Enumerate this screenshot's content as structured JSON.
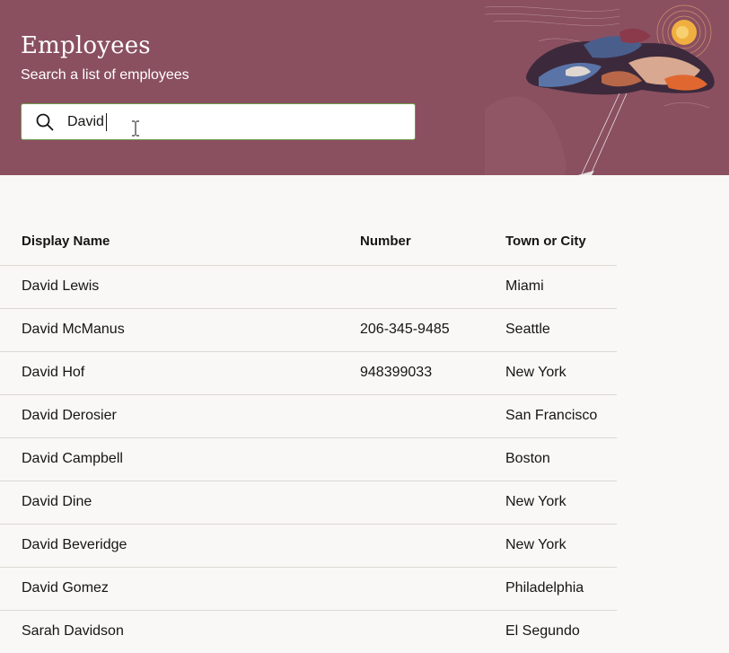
{
  "header": {
    "title": "Employees",
    "subtitle": "Search a list of employees",
    "background_color": "#8a5060"
  },
  "search": {
    "icon": "search-icon",
    "value": "David"
  },
  "table": {
    "columns": [
      "Display Name",
      "Number",
      "Town or City"
    ],
    "rows": [
      {
        "name": "David Lewis",
        "number": "",
        "city": "Miami"
      },
      {
        "name": "David McManus",
        "number": "206-345-9485",
        "city": "Seattle"
      },
      {
        "name": "David Hof",
        "number": "948399033",
        "city": "New York"
      },
      {
        "name": "David Derosier",
        "number": "",
        "city": "San Francisco"
      },
      {
        "name": "David Campbell",
        "number": "",
        "city": "Boston"
      },
      {
        "name": "David Dine",
        "number": "",
        "city": "New York"
      },
      {
        "name": "David Beveridge",
        "number": "",
        "city": "New York"
      },
      {
        "name": "David Gomez",
        "number": "",
        "city": "Philadelphia"
      },
      {
        "name": "Sarah Davidson",
        "number": "",
        "city": "El Segundo"
      }
    ]
  }
}
